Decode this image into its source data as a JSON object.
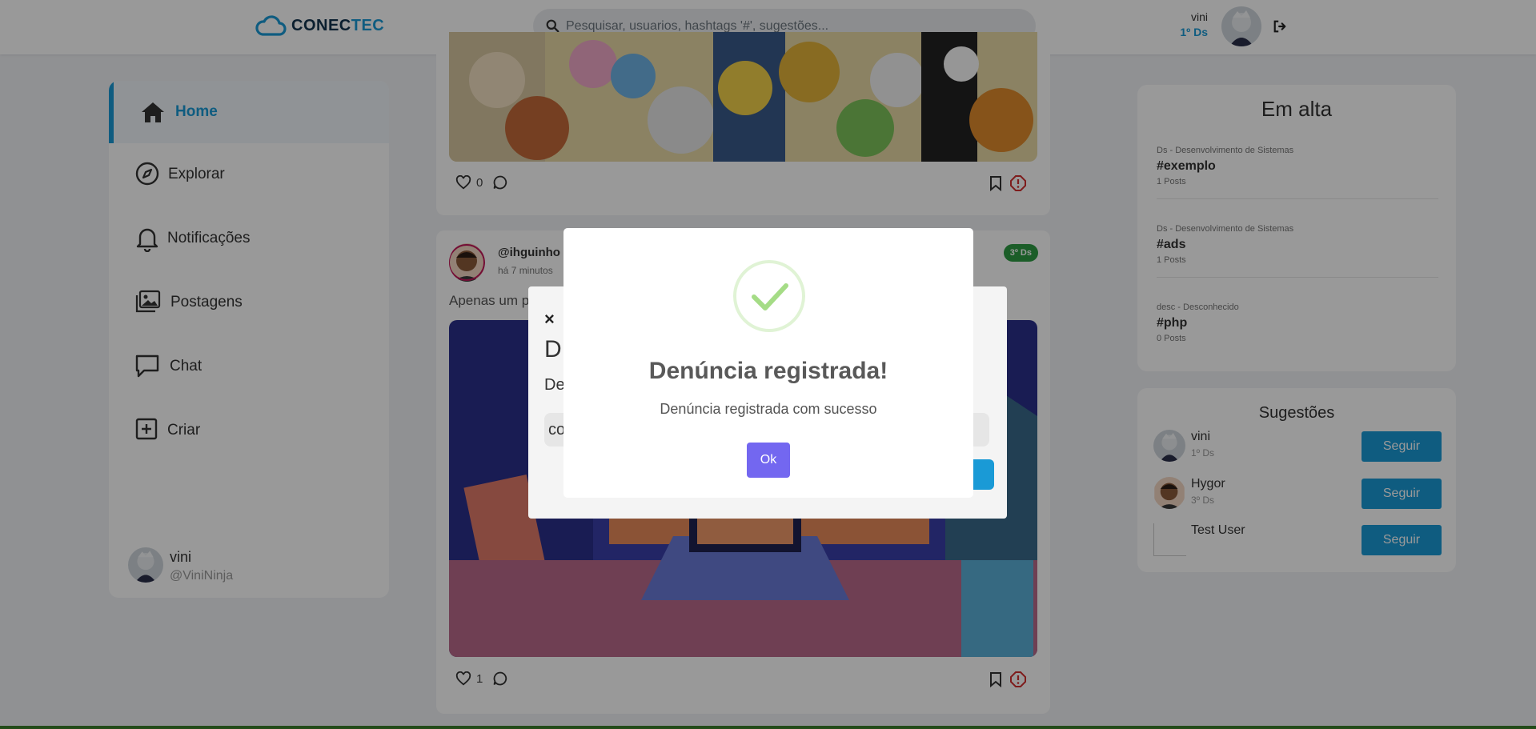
{
  "header": {
    "logo_part1": "CONEC",
    "logo_part2": "TEC",
    "search_placeholder": "Pesquisar, usuarios, hashtags '#', sugestões...",
    "user_name": "vini",
    "user_class": "1º Ds"
  },
  "sidebar": {
    "items": [
      {
        "label": "Home",
        "icon": "home-icon"
      },
      {
        "label": "Explorar",
        "icon": "compass-icon"
      },
      {
        "label": "Notificações",
        "icon": "bell-icon"
      },
      {
        "label": "Postagens",
        "icon": "images-icon"
      },
      {
        "label": "Chat",
        "icon": "chat-icon"
      },
      {
        "label": "Criar",
        "icon": "plus-square-icon"
      }
    ],
    "user": {
      "name": "vini",
      "handle": "@ViniNinja"
    }
  },
  "feed": {
    "post1": {
      "likes": "0"
    },
    "post2": {
      "user": "@ihguinho",
      "time": "há 7 minutos",
      "badge": "3º Ds",
      "text": "Apenas um p",
      "likes": "1"
    }
  },
  "trending": {
    "title": "Em alta",
    "items": [
      {
        "category": "Ds - Desenvolvimento de Sistemas",
        "tag": "#exemplo",
        "count": "1 Posts"
      },
      {
        "category": "Ds - Desenvolvimento de Sistemas",
        "tag": "#ads",
        "count": "1 Posts"
      },
      {
        "category": "desc - Desconhecido",
        "tag": "#php",
        "count": "0 Posts"
      }
    ]
  },
  "suggestions": {
    "title": "Sugestões",
    "follow_label": "Seguir",
    "items": [
      {
        "name": "vini",
        "class": "1º Ds"
      },
      {
        "name": "Hygor",
        "class": "3º Ds"
      },
      {
        "name": "Test User",
        "class": ""
      }
    ]
  },
  "report_modal": {
    "close": "×",
    "title_fragment": "D",
    "subtitle_fragment": "De",
    "input_fragment": "co"
  },
  "alert": {
    "title": "Denúncia registrada!",
    "text": "Denúncia registrada com sucesso",
    "ok": "Ok"
  },
  "colors": {
    "brand": "#1a9ad6",
    "alert_button": "#7367f0",
    "success": "#a5dc86",
    "badge_green": "#2e9c44"
  }
}
